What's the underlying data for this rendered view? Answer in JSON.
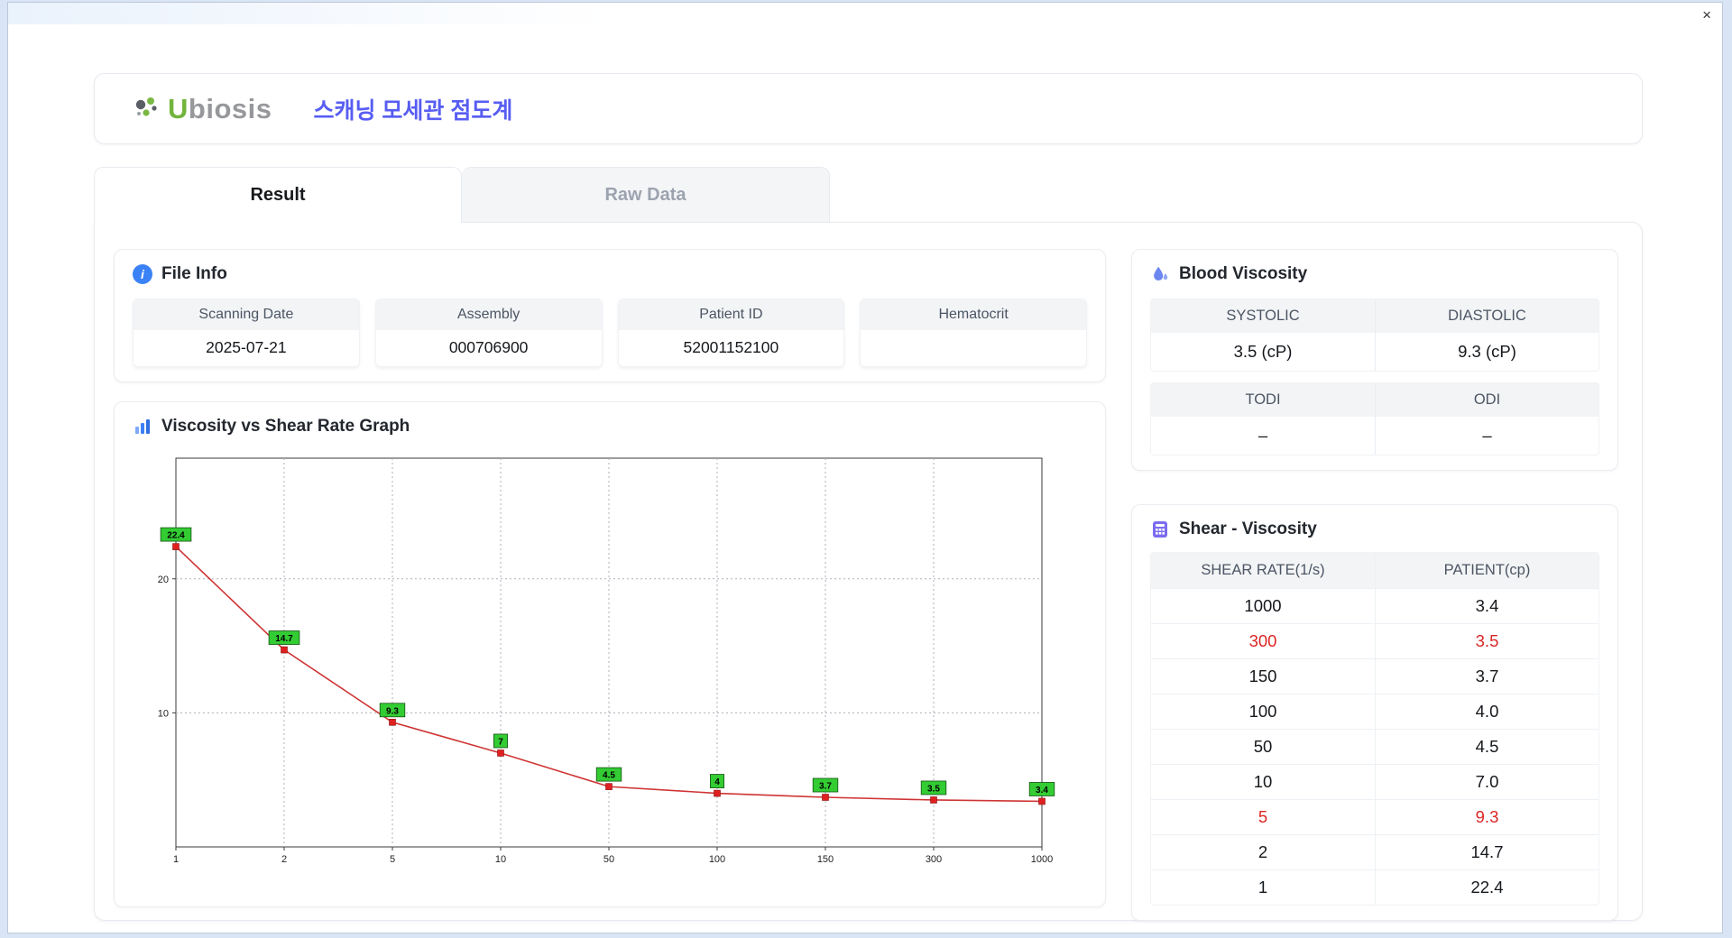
{
  "window": {
    "close_glyph": "×"
  },
  "header": {
    "brand_u": "U",
    "brand_rest": "biosis",
    "title": "스캐닝 모세관 점도계"
  },
  "tabs": [
    {
      "label": "Result",
      "active": true
    },
    {
      "label": "Raw Data",
      "active": false
    }
  ],
  "file_info": {
    "title": "File Info",
    "fields": [
      {
        "label": "Scanning Date",
        "value": "2025-07-21"
      },
      {
        "label": "Assembly",
        "value": "000706900"
      },
      {
        "label": "Patient ID",
        "value": "52001152100"
      },
      {
        "label": "Hematocrit",
        "value": ""
      }
    ]
  },
  "graph_card": {
    "title": "Viscosity vs Shear Rate Graph"
  },
  "blood_viscosity": {
    "title": "Blood Viscosity",
    "cells": [
      {
        "label": "SYSTOLIC",
        "value": "3.5 (cP)"
      },
      {
        "label": "DIASTOLIC",
        "value": "9.3 (cP)"
      },
      {
        "label": "TODI",
        "value": "–"
      },
      {
        "label": "ODI",
        "value": "–"
      }
    ]
  },
  "shear_viscosity": {
    "title": "Shear - Viscosity",
    "columns": [
      "SHEAR RATE(1/s)",
      "PATIENT(cp)"
    ],
    "rows": [
      {
        "shear_rate": "1000",
        "patient": "3.4",
        "highlight": false
      },
      {
        "shear_rate": "300",
        "patient": "3.5",
        "highlight": true
      },
      {
        "shear_rate": "150",
        "patient": "3.7",
        "highlight": false
      },
      {
        "shear_rate": "100",
        "patient": "4.0",
        "highlight": false
      },
      {
        "shear_rate": "50",
        "patient": "4.5",
        "highlight": false
      },
      {
        "shear_rate": "10",
        "patient": "7.0",
        "highlight": false
      },
      {
        "shear_rate": "5",
        "patient": "9.3",
        "highlight": true
      },
      {
        "shear_rate": "2",
        "patient": "14.7",
        "highlight": false
      },
      {
        "shear_rate": "1",
        "patient": "22.4",
        "highlight": false
      }
    ]
  },
  "chart_data": {
    "type": "line",
    "title": "Viscosity vs Shear Rate Graph",
    "xlabel": "",
    "ylabel": "",
    "categories": [
      "1",
      "2",
      "5",
      "10",
      "50",
      "100",
      "150",
      "300",
      "1000"
    ],
    "values": [
      22.4,
      14.7,
      9.3,
      7,
      4.5,
      4,
      3.7,
      3.5,
      3.4
    ],
    "point_labels": [
      "22.4",
      "14.7",
      "9.3",
      "7",
      "4.5",
      "4",
      "3.7",
      "3.5",
      "3.4"
    ],
    "ylim": [
      0,
      29
    ],
    "yticks": [
      10,
      20
    ],
    "grid": true,
    "legend": "none",
    "line_color": "#cf3434",
    "marker_color": "#e02020",
    "label_bg": "#33cc33",
    "label_border": "#145214"
  },
  "icons": {
    "info_glyph": "i"
  },
  "colors": {
    "accent_title": "#575df2",
    "brand_green": "#73b43d",
    "highlight_red": "#dc2626",
    "header_gray": "#f3f4f6",
    "icon_blue": "#3b82f6",
    "icon_droplet": "#6d87f0",
    "icon_calculator": "#7b6cf0"
  }
}
